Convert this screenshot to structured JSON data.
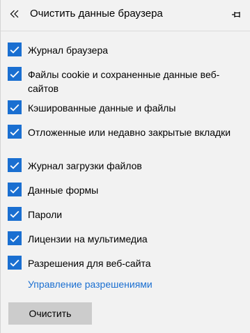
{
  "colors": {
    "accent": "#1a6fd1",
    "background": "#f2f2f2",
    "button": "#cccccc"
  },
  "header": {
    "back_icon": "double-chevron-left-icon",
    "title": "Очистить данные браузера",
    "pin_icon": "pin-icon"
  },
  "items": [
    {
      "label": "Журнал браузера",
      "checked": true
    },
    {
      "label": "Файлы cookie и сохраненные данные веб-сайтов",
      "checked": true
    },
    {
      "label": "Кэшированные данные и файлы",
      "checked": true
    },
    {
      "label": "Отложенные или недавно закрытые вкладки",
      "checked": true
    },
    {
      "label": "Журнал загрузки файлов",
      "checked": true
    },
    {
      "label": "Данные формы",
      "checked": true
    },
    {
      "label": "Пароли",
      "checked": true
    },
    {
      "label": "Лицензии на мультимедиа",
      "checked": true
    },
    {
      "label": "Разрешения для веб-сайта",
      "checked": true
    }
  ],
  "manage_link": "Управление разрешениями",
  "clear_button": "Очистить"
}
